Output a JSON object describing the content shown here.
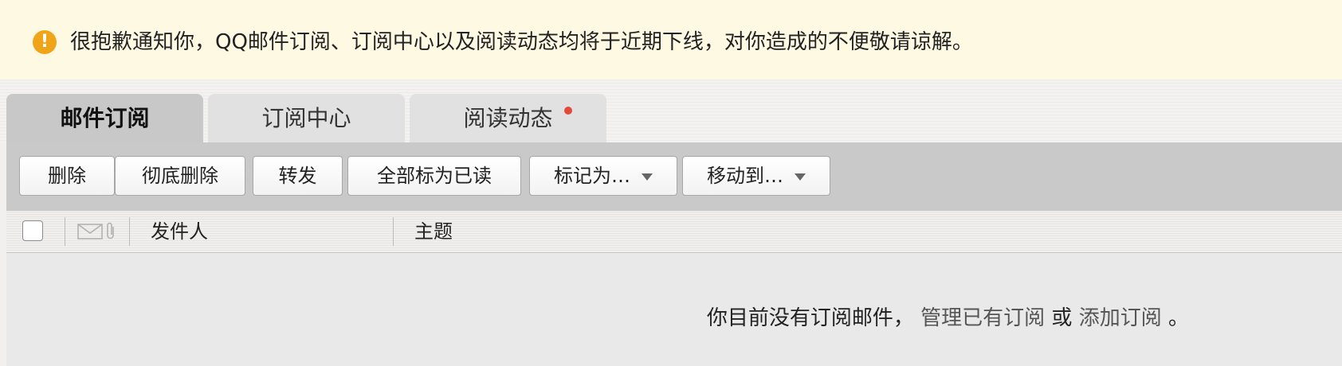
{
  "notice": {
    "icon": "exclamation-icon",
    "icon_glyph": "!",
    "text": "很抱歉通知你，QQ邮件订阅、订阅中心以及阅读动态均将于近期下线，对你造成的不便敬请谅解。"
  },
  "tabs": [
    {
      "label": "邮件订阅",
      "active": true
    },
    {
      "label": "订阅中心",
      "active": false
    },
    {
      "label": "阅读动态",
      "active": false,
      "has_notification_dot": true
    }
  ],
  "toolbar": {
    "delete": "删除",
    "delete_permanently": "彻底删除",
    "forward": "转发",
    "mark_all_read": "全部标为已读",
    "mark_as": "标记为…",
    "move_to": "移动到…"
  },
  "columns": {
    "icons": [
      "envelope-icon",
      "paperclip-icon"
    ],
    "sender": "发件人",
    "subject": "主题"
  },
  "empty": {
    "message": "你目前没有订阅邮件，",
    "manage_link": "管理已有订阅",
    "or": "或",
    "add_link": "添加订阅",
    "end": "。"
  },
  "colors": {
    "notice_bg": "#fdf9e3",
    "notice_icon": "#f0a518",
    "toolbar_bg": "#c9c9c9",
    "notification_dot": "#e14a3a"
  }
}
